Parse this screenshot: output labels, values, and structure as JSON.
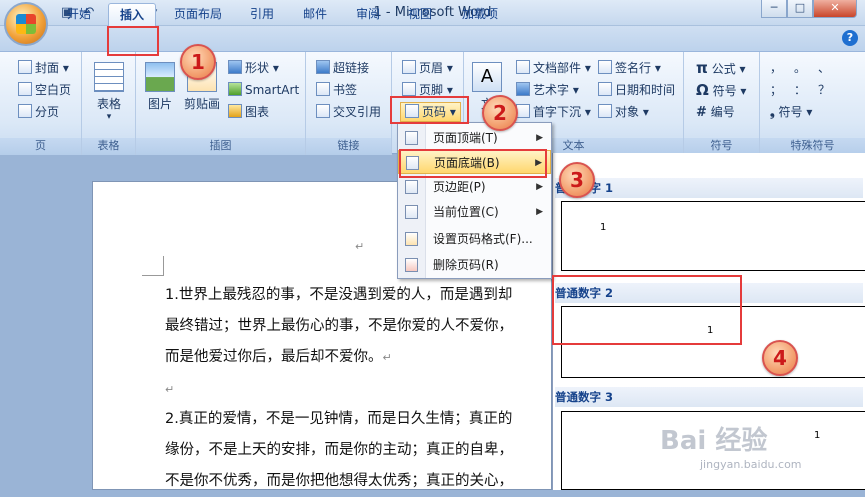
{
  "window": {
    "title": "1 - Microsoft Word",
    "minimize": "─",
    "maximize": "□",
    "close": "✕"
  },
  "qat": {
    "save_icon": "save-icon",
    "undo": "↶",
    "redo": "↷",
    "more": "▾"
  },
  "tabs": [
    "开始",
    "插入",
    "页面布局",
    "引用",
    "邮件",
    "审阅",
    "视图",
    "加载项"
  ],
  "help": "?",
  "ribbon": {
    "pages_group": {
      "label": "页",
      "items": [
        "封面",
        "空白页",
        "分页"
      ]
    },
    "table_group": {
      "label": "表格",
      "button": "表格"
    },
    "illustrations_group": {
      "label": "插图",
      "picture": "图片",
      "clipart": "剪贴画",
      "shapes": "形状",
      "smartart": "SmartArt",
      "chart": "图表"
    },
    "links_group": {
      "label": "链接",
      "items": [
        "超链接",
        "书签",
        "交叉引用"
      ]
    },
    "header_footer_group": {
      "header": "页眉",
      "footer": "页脚",
      "page_number": "页码"
    },
    "text_group": {
      "label": "文本",
      "textbox": "文",
      "items": [
        "文档部件",
        "艺术字",
        "首字下沉",
        "签名行",
        "日期和时间",
        "对象"
      ]
    },
    "symbols_group": {
      "label": "符号",
      "items": [
        "公式",
        "符号",
        "编号"
      ]
    },
    "special_group": {
      "label": "特殊符号",
      "chars": [
        "，",
        "。",
        "、",
        "；",
        "：",
        "？"
      ],
      "symbol": "符号"
    }
  },
  "menu": {
    "items": [
      {
        "label": "页面顶端(T)",
        "has_arrow": true
      },
      {
        "label": "页面底端(B)",
        "has_arrow": true
      },
      {
        "label": "页边距(P)",
        "has_arrow": true
      },
      {
        "label": "当前位置(C)",
        "has_arrow": true
      },
      {
        "label": "设置页码格式(F)...",
        "has_arrow": false
      },
      {
        "label": "删除页码(R)",
        "has_arrow": false
      }
    ],
    "arrow": "▶"
  },
  "gallery": {
    "items": [
      {
        "title": "普通数字 1",
        "number": "1"
      },
      {
        "title": "普通数字 2",
        "number": "1"
      },
      {
        "title": "普通数字 3",
        "number": "1"
      }
    ]
  },
  "document": {
    "paragraphs": [
      "1.世界上最残忍的事，不是没遇到爱的人，而是遇到却",
      "最终错过；世界上最伤心的事，不是你爱的人不爱你，",
      "而是他爱过你后，最后却不爱你。",
      "2.真正的爱情，不是一见钟情，而是日久生情；真正的",
      "缘份，不是上天的安排，而是你的主动；真正的自卑，",
      "不是你不优秀，而是你把他想得太优秀；真正的关心，"
    ],
    "return_mark": "↵"
  },
  "callouts": [
    "1",
    "2",
    "3",
    "4"
  ],
  "watermark": {
    "main": "Bai 经验",
    "sub": "jingyan.baidu.com"
  },
  "colors": {
    "accent": "#e53b3b",
    "highlight": "#ffd76e",
    "ribbon": "#dbe8f7"
  }
}
